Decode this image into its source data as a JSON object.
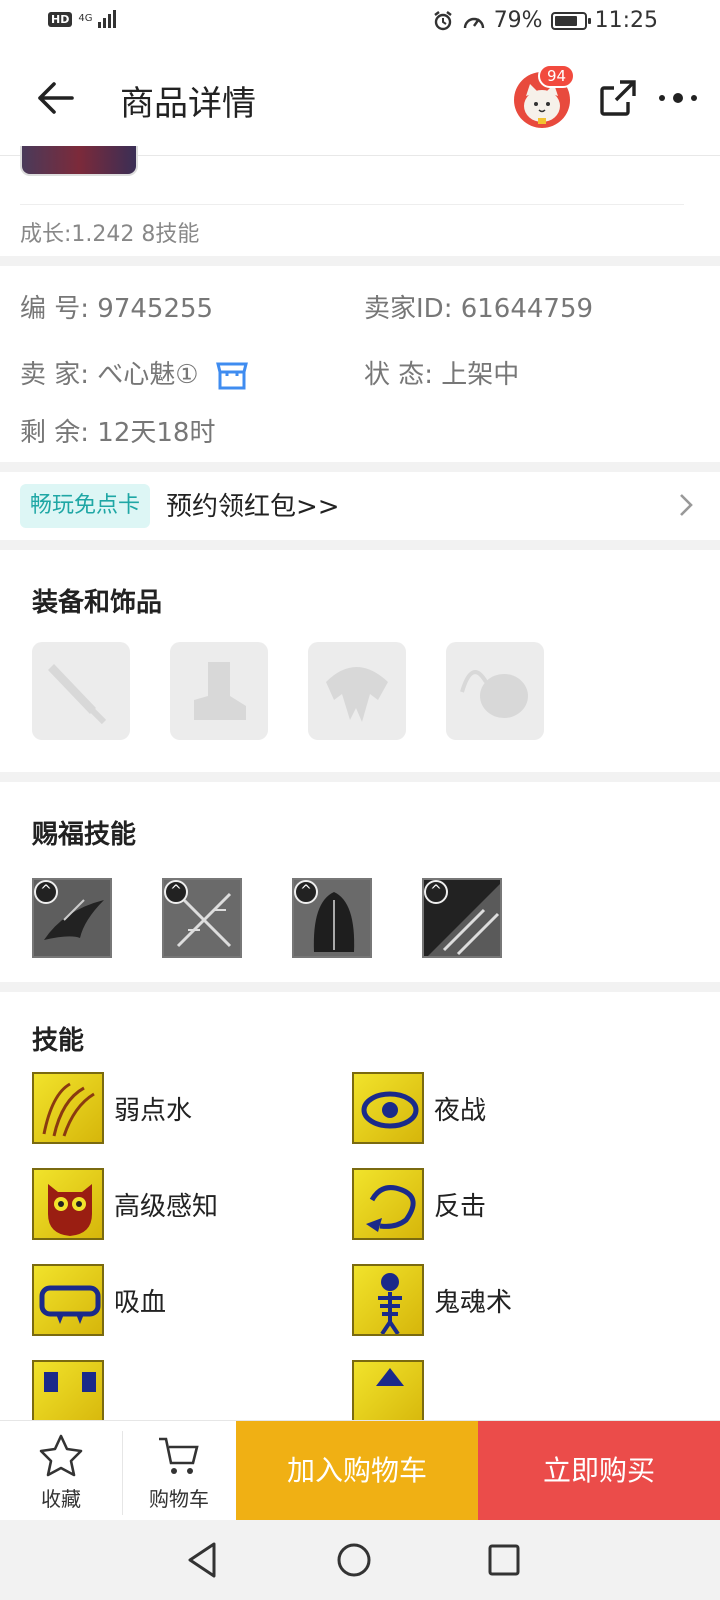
{
  "status_bar": {
    "network_badge": "HD",
    "signal_label": "4G",
    "battery_percent": "79%",
    "battery_level": 0.79,
    "time": "11:25"
  },
  "header": {
    "title": "商品详情",
    "notification_count": "94"
  },
  "summary": {
    "growth": "成长:1.242 8技能"
  },
  "info": {
    "id_label": "编  号:",
    "id_value": "9745255",
    "seller_id_label": "卖家ID:",
    "seller_id_value": "61644759",
    "seller_label": "卖  家:",
    "seller_value": "べ心魅①",
    "status_label": "状  态:",
    "status_value": "上架中",
    "remaining_label": "剩  余:",
    "remaining_value": "12天18时"
  },
  "promo": {
    "tag": "畅玩免点卡",
    "text": "预约领红包>>"
  },
  "equipment": {
    "title": "装备和饰品",
    "slots": [
      "weapon-slot-icon",
      "boots-slot-icon",
      "armor-slot-icon",
      "accessory-slot-icon"
    ]
  },
  "blessing": {
    "title": "赐福技能",
    "icons": [
      "eagle-icon",
      "dual-sword-icon",
      "hooded-figure-icon",
      "arrow-strike-icon"
    ]
  },
  "skills": {
    "title": "技能",
    "items": [
      {
        "name": "弱点水",
        "icon": "weakness-water-icon"
      },
      {
        "name": "夜战",
        "icon": "night-eye-icon"
      },
      {
        "name": "高级感知",
        "icon": "owl-icon"
      },
      {
        "name": "反击",
        "icon": "counter-arrow-icon"
      },
      {
        "name": "吸血",
        "icon": "fangs-icon"
      },
      {
        "name": "鬼魂术",
        "icon": "skeleton-icon"
      }
    ]
  },
  "bottom_bar": {
    "favorite_label": "收藏",
    "cart_label": "购物车",
    "add_to_cart": "加入购物车",
    "buy_now": "立即购买"
  },
  "colors": {
    "cart_button": "#f0b014",
    "buy_button": "#eb4c4a",
    "promo_tag_bg": "#ddf6f5",
    "promo_tag_text": "#1fa7a5",
    "shop_icon": "#3f8cf0"
  }
}
